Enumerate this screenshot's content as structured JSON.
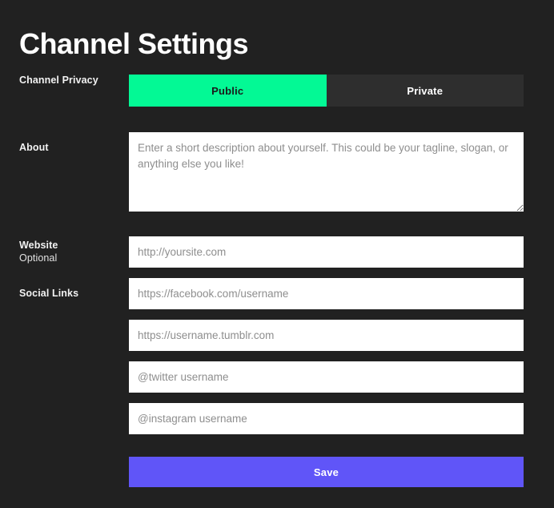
{
  "page": {
    "title": "Channel Settings",
    "background_color": "#212121"
  },
  "colors": {
    "accent_green": "#03f995",
    "accent_purple": "#6055f8",
    "toggle_inactive": "#2e2e2e",
    "input_background": "#ffffff",
    "placeholder_text": "#8e8e8e",
    "label_text": "#f2f2f2"
  },
  "privacy": {
    "label": "Channel Privacy",
    "options": [
      {
        "label": "Public",
        "selected": true
      },
      {
        "label": "Private",
        "selected": false
      }
    ]
  },
  "about": {
    "label": "About",
    "value": "",
    "placeholder": "Enter a short description about yourself. This could be your tagline, slogan, or anything else you like!"
  },
  "website": {
    "label": "Website",
    "sublabel": "Optional",
    "value": "",
    "placeholder": "http://yoursite.com"
  },
  "social": {
    "label": "Social Links",
    "fields": [
      {
        "name": "facebook",
        "value": "",
        "placeholder": "https://facebook.com/username"
      },
      {
        "name": "tumblr",
        "value": "",
        "placeholder": "https://username.tumblr.com"
      },
      {
        "name": "twitter",
        "value": "",
        "placeholder": "@twitter username"
      },
      {
        "name": "instagram",
        "value": "",
        "placeholder": "@instagram username"
      }
    ]
  },
  "actions": {
    "save_label": "Save"
  }
}
